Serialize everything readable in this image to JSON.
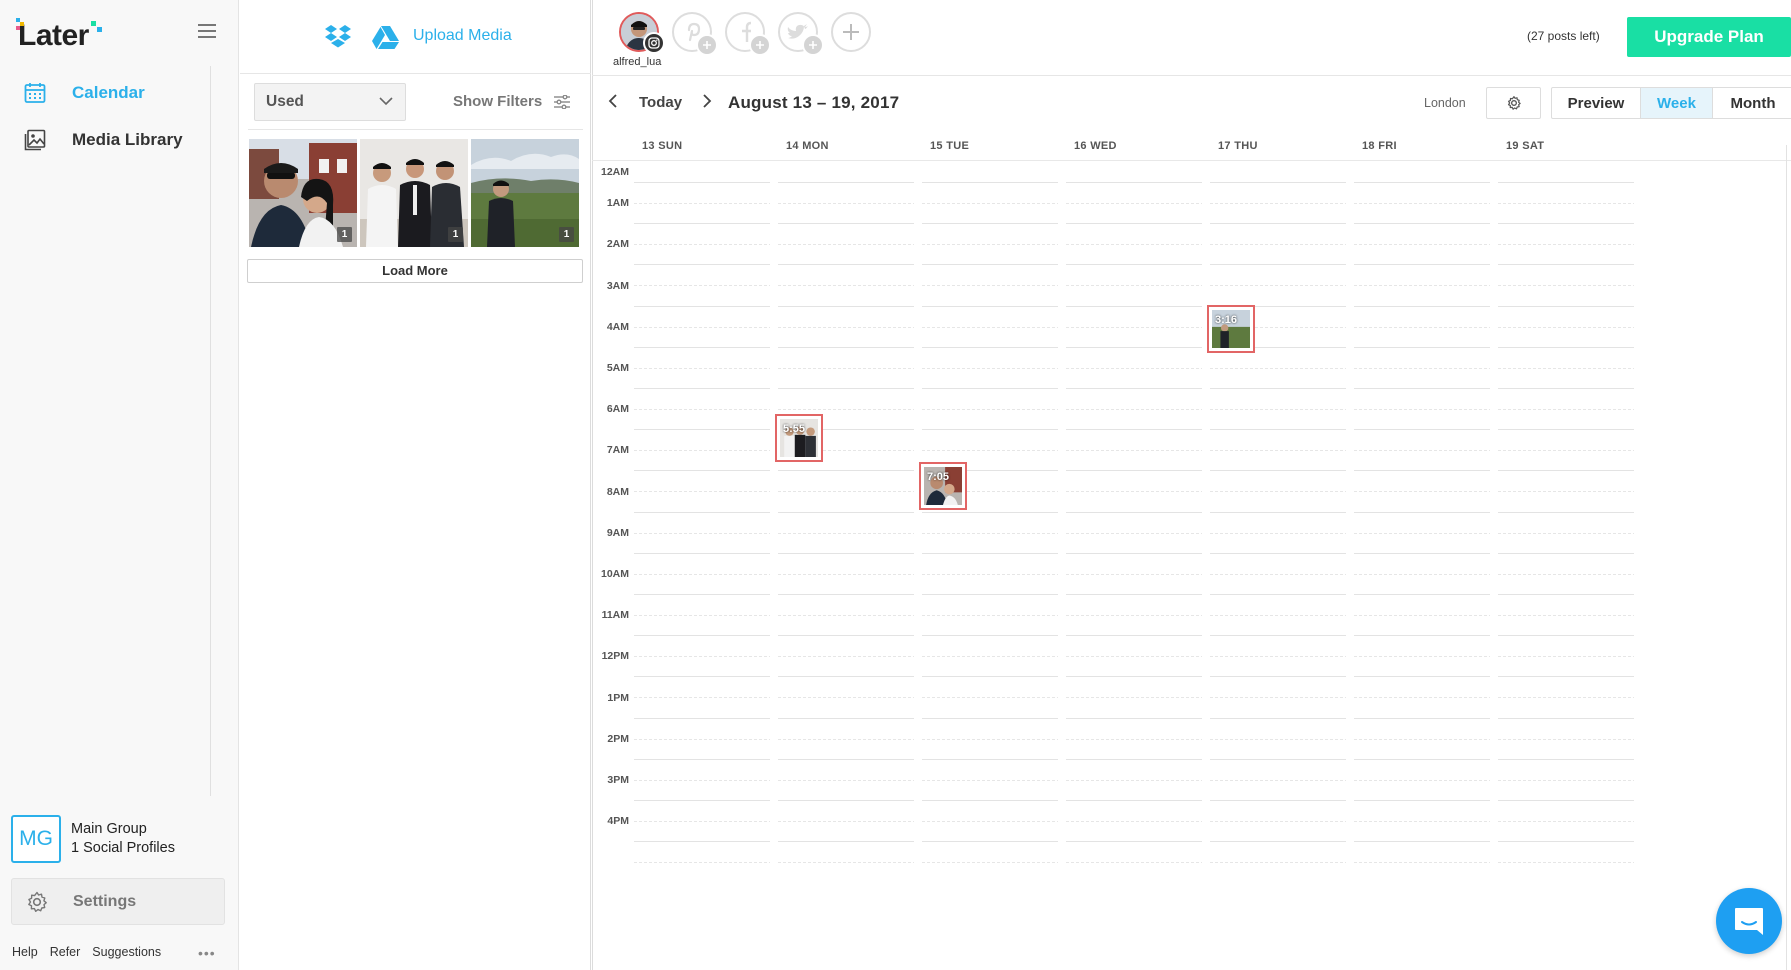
{
  "app": {
    "logo_text": "Later",
    "brand_blue": "#2bb0ea",
    "upgrade_green": "#19dfa4",
    "post_border_red": "#e26565"
  },
  "sidebar": {
    "items": [
      {
        "label": "Calendar",
        "icon": "calendar-icon",
        "active": true
      },
      {
        "label": "Media Library",
        "icon": "media-library-icon",
        "active": false
      }
    ],
    "group": {
      "initials": "MG",
      "name": "Main Group",
      "profiles": "1 Social Profiles"
    },
    "settings_label": "Settings",
    "footer": [
      "Help",
      "Refer",
      "Suggestions"
    ],
    "more": "•••"
  },
  "media": {
    "upload_label": "Upload Media",
    "filter_value": "Used",
    "show_filters": "Show Filters",
    "thumbs": [
      {
        "badge": "1",
        "desc": "selfie couple brick houses"
      },
      {
        "badge": "1",
        "desc": "three men standing"
      },
      {
        "badge": "1",
        "desc": "man on grass field"
      }
    ],
    "load_more": "Load More"
  },
  "profiles": {
    "active_name": "alfred_lua",
    "add_networks": [
      "pinterest-icon",
      "facebook-icon",
      "twitter-icon"
    ],
    "posts_left": "(27 posts left)",
    "upgrade_label": "Upgrade Plan"
  },
  "toolbar": {
    "today": "Today",
    "range": "August 13 – 19, 2017",
    "timezone": "London",
    "views": [
      "Preview",
      "Week",
      "Month"
    ],
    "active_view": "Week"
  },
  "week": {
    "days": [
      "13 SUN",
      "14 MON",
      "15 TUE",
      "16 WED",
      "17 THU",
      "18 FRI",
      "19 SAT"
    ],
    "hours": [
      "12AM",
      "1AM",
      "2AM",
      "3AM",
      "4AM",
      "5AM",
      "6AM",
      "7AM",
      "8AM",
      "9AM",
      "10AM",
      "11AM",
      "12PM",
      "1PM",
      "2PM",
      "3PM",
      "4PM"
    ],
    "posts": [
      {
        "day": "14 MON",
        "time": "5:55"
      },
      {
        "day": "15 TUE",
        "time": "7:05"
      },
      {
        "day": "17 THU",
        "time": "3:16"
      }
    ]
  }
}
